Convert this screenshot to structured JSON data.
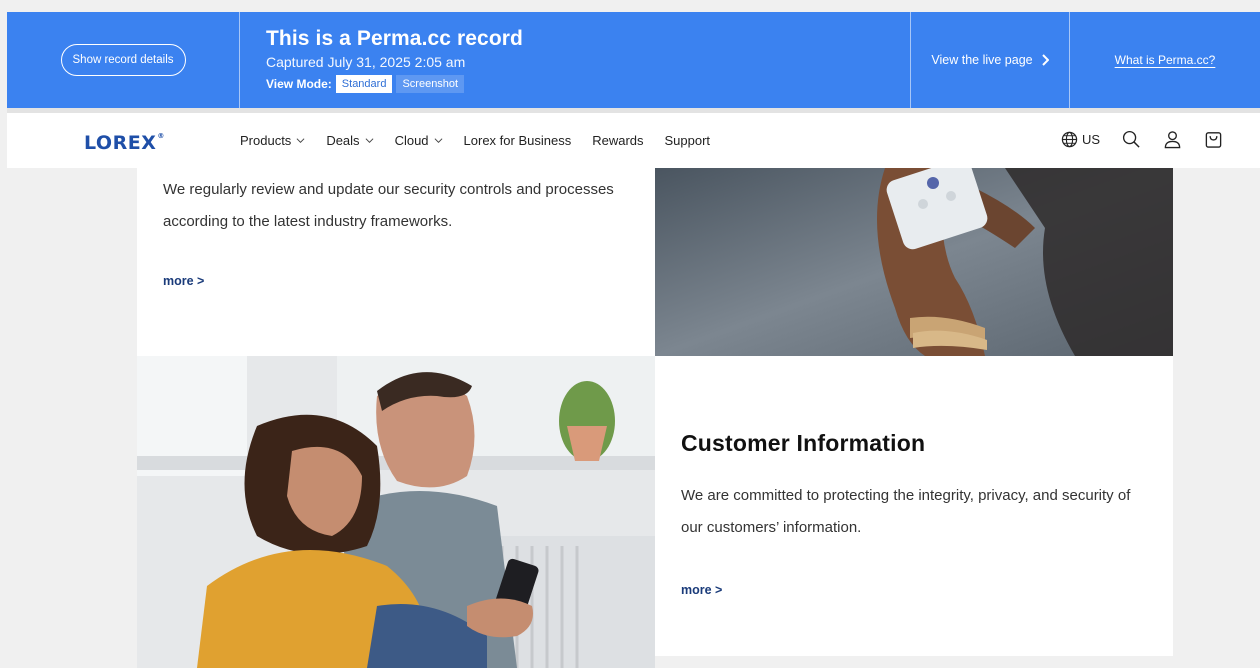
{
  "perma": {
    "show_details": "Show record details",
    "title": "This is a Perma.cc record",
    "captured": "Captured July 31, 2025 2:05 am",
    "view_mode_label": "View Mode:",
    "mode_standard": "Standard",
    "mode_screenshot": "Screenshot",
    "live_page": "View the live page",
    "what_is": "What is Perma.cc?"
  },
  "nav": {
    "logo": "LOREX",
    "logo_mark": "®",
    "menu": [
      {
        "label": "Products"
      },
      {
        "label": "Deals"
      },
      {
        "label": "Cloud"
      },
      {
        "label": "Lorex for Business"
      },
      {
        "label": "Rewards"
      },
      {
        "label": "Support"
      }
    ],
    "locale": "US"
  },
  "sections": {
    "security": {
      "text": "We regularly review and update our security controls and processes according to the latest industry frameworks.",
      "more": "more >"
    },
    "customer": {
      "heading": "Customer Information",
      "text": "We are committed to protecting the integrity, privacy, and security of our customers’ information.",
      "more": "more >"
    }
  },
  "colors": {
    "perma_blue": "#3b82f0",
    "lorex_blue": "#1f4fa8",
    "link_navy": "#1a3b7a"
  }
}
